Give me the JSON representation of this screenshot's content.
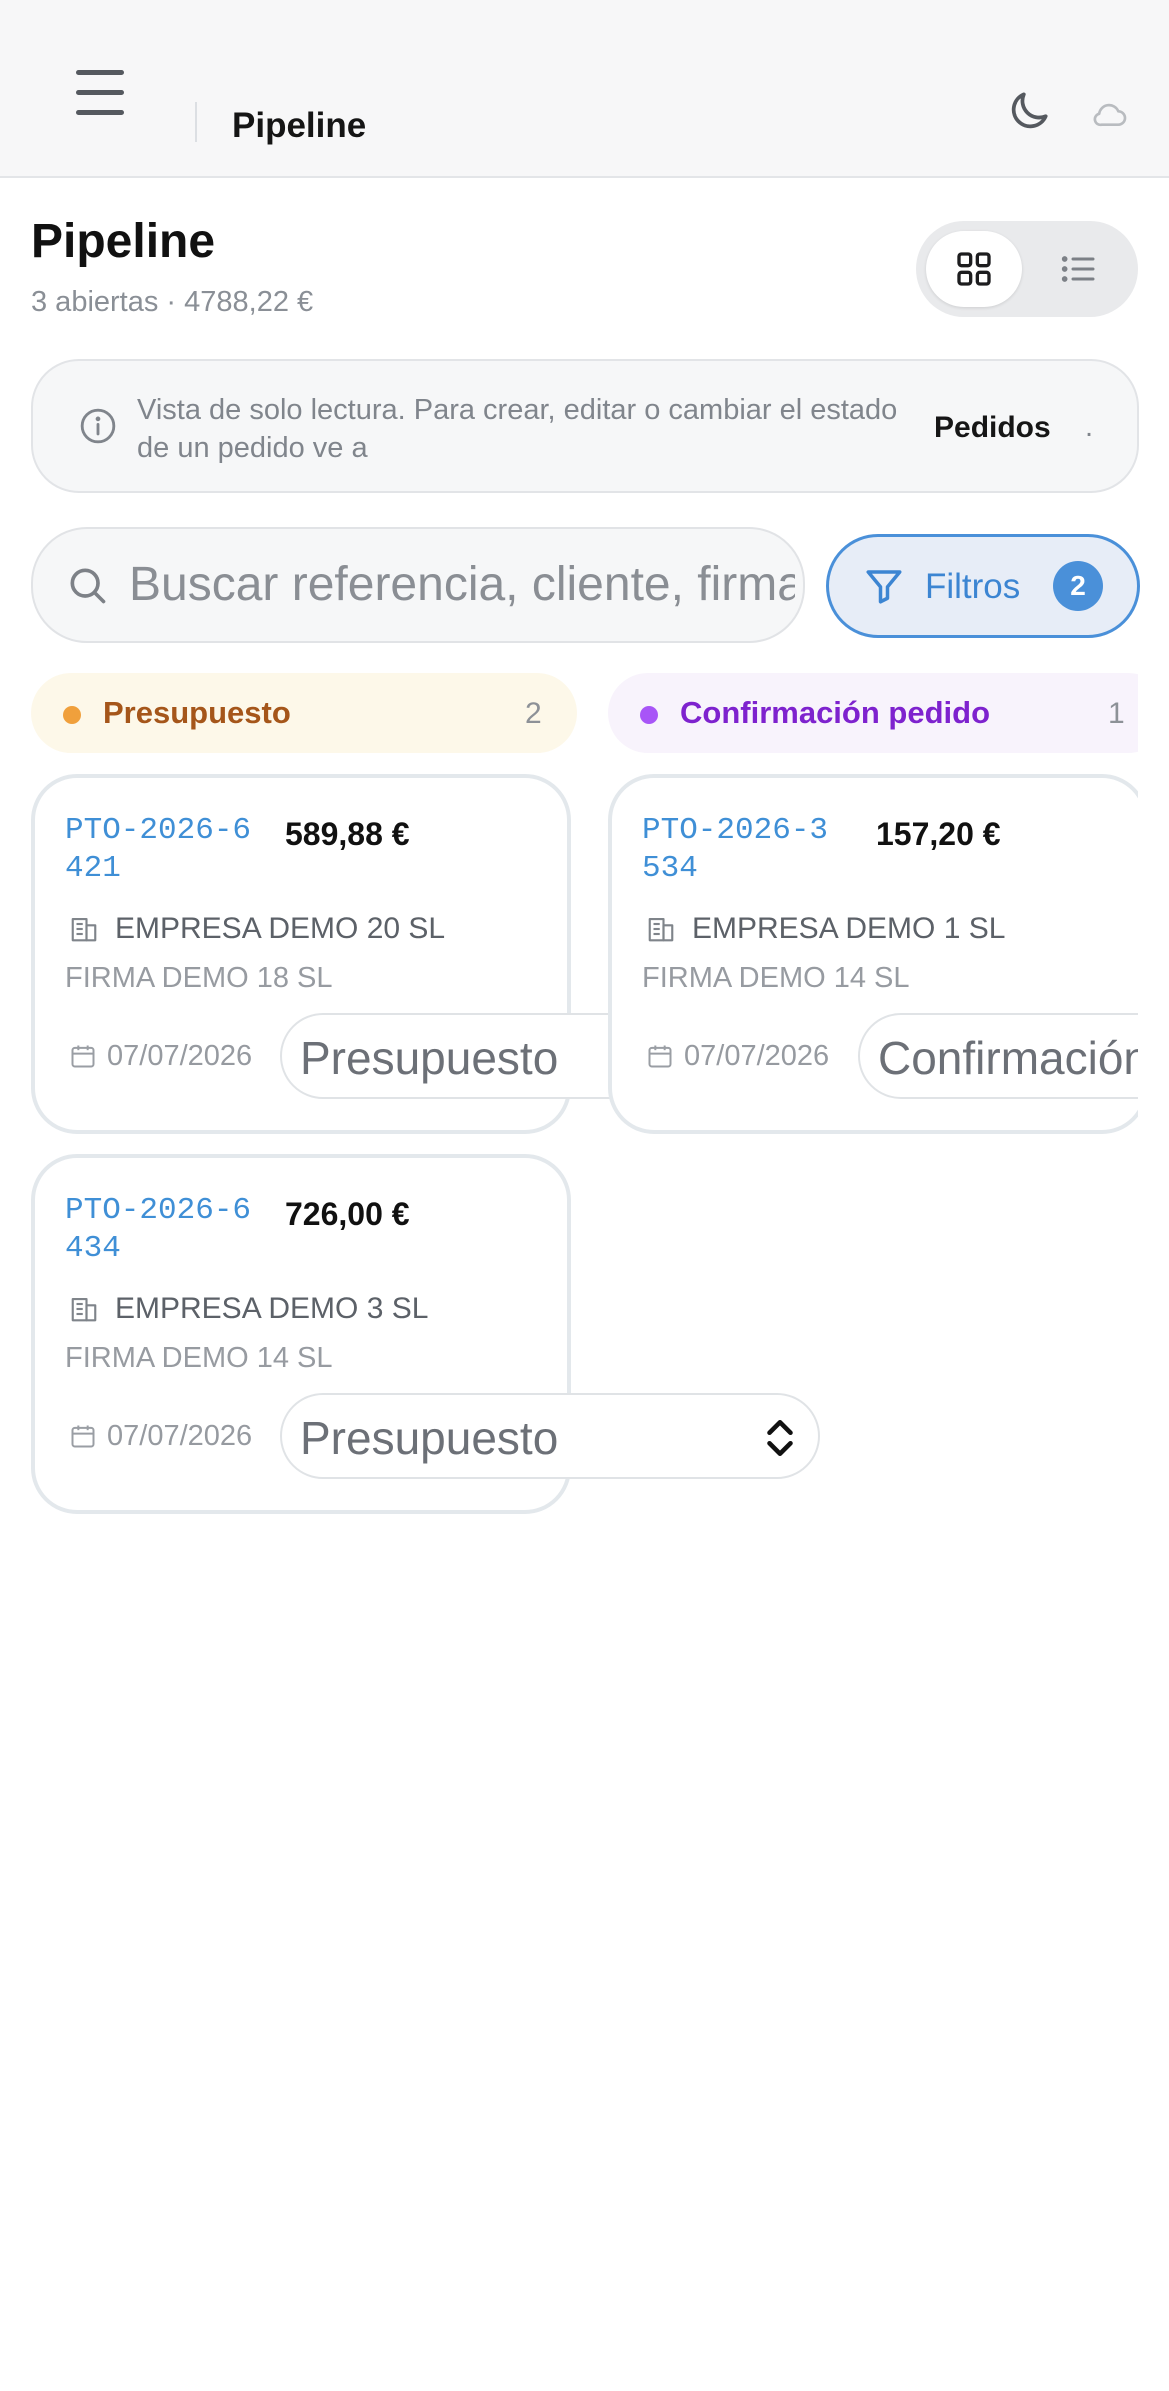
{
  "topbar": {
    "title": "Pipeline",
    "menu_icon": "hamburger-menu-icon",
    "theme_icon": "moon-icon",
    "sync_icon": "cloud-icon"
  },
  "header": {
    "title": "Pipeline",
    "subtitle": "3 abiertas · 4788,22 €",
    "view_modes": [
      "grid-view-icon",
      "list-view-icon"
    ],
    "active_view": "grid"
  },
  "notice": {
    "text": "Vista de solo lectura. Para crear, editar o cambiar el estado de un pedido ve a",
    "link": "Pedidos",
    "suffix": "."
  },
  "search": {
    "placeholder": "Buscar referencia, cliente, firma..."
  },
  "filters": {
    "label": "Filtros",
    "count": "2"
  },
  "columns": [
    {
      "label": "Presupuesto",
      "count": "2",
      "color": "#f0a03c",
      "label_color": "#a5561a",
      "background": "#fdf8e9",
      "cards": [
        {
          "ref": "PTO-2026-6421",
          "amount": "589,88 €",
          "company": "EMPRESA DEMO 20 SL",
          "firm": "FIRMA DEMO 18 SL",
          "date": "07/07/2026",
          "stage": "Presupuesto"
        },
        {
          "ref": "PTO-2026-6434",
          "amount": "726,00 €",
          "company": "EMPRESA DEMO 3 SL",
          "firm": "FIRMA DEMO 14 SL",
          "date": "07/07/2026",
          "stage": "Presupuesto"
        }
      ]
    },
    {
      "label": "Confirmación pedido",
      "count": "1",
      "color": "#a855f7",
      "label_color": "#7e22ce",
      "background": "#f8f3fc",
      "cards": [
        {
          "ref": "PTO-2026-3534",
          "amount": "157,20 €",
          "company": "EMPRESA DEMO 1 SL",
          "firm": "FIRMA DEMO 14 SL",
          "date": "07/07/2026",
          "stage": "Confirmación pedido"
        }
      ]
    }
  ]
}
